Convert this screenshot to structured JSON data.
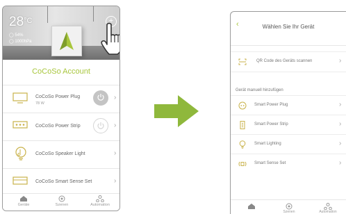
{
  "left_app": {
    "hero": {
      "temperature": "28",
      "temp_unit": "°C",
      "humidity": "54%",
      "pressure": "1000hPa",
      "add_icon": "plus-icon"
    },
    "account_title": "CoCoSo Account",
    "devices": [
      {
        "name": "CoCoSo Power Plug",
        "sub": "78 W",
        "icon": "power-plug-icon",
        "power_state": "on"
      },
      {
        "name": "CoCoSo Power Strip",
        "sub": "",
        "icon": "power-strip-icon",
        "power_state": "off"
      },
      {
        "name": "CoCoSo Speaker Light",
        "sub": "",
        "icon": "speaker-light-icon",
        "power_state": ""
      },
      {
        "name": "CoCoSo Smart Sense Set",
        "sub": "",
        "icon": "sense-set-icon",
        "power_state": ""
      }
    ],
    "tabs": [
      {
        "label": "Geräte",
        "icon": "home-icon"
      },
      {
        "label": "Szenen",
        "icon": "scenes-icon"
      },
      {
        "label": "Automation",
        "icon": "automation-icon"
      }
    ]
  },
  "arrow_color": "#8fb83c",
  "accent_color": "#a8c63c",
  "right_app": {
    "title": "Wählen Sie Ihr Gerät",
    "qr_label": "QR Code des Geräts scannen",
    "manual_section": "Gerät manuell hinzufügen",
    "device_types": [
      {
        "label": "Smart Power Plug",
        "icon": "plug-icon"
      },
      {
        "label": "Smart Power Strip",
        "icon": "strip-icon"
      },
      {
        "label": "Smart Lighting",
        "icon": "bulb-icon"
      },
      {
        "label": "Smart Sense Set",
        "icon": "sensor-icon"
      }
    ],
    "tabs": [
      {
        "label": "",
        "icon": "home-icon"
      },
      {
        "label": "Szenen",
        "icon": "scenes-icon"
      },
      {
        "label": "Automation",
        "icon": "automation-icon"
      }
    ]
  }
}
